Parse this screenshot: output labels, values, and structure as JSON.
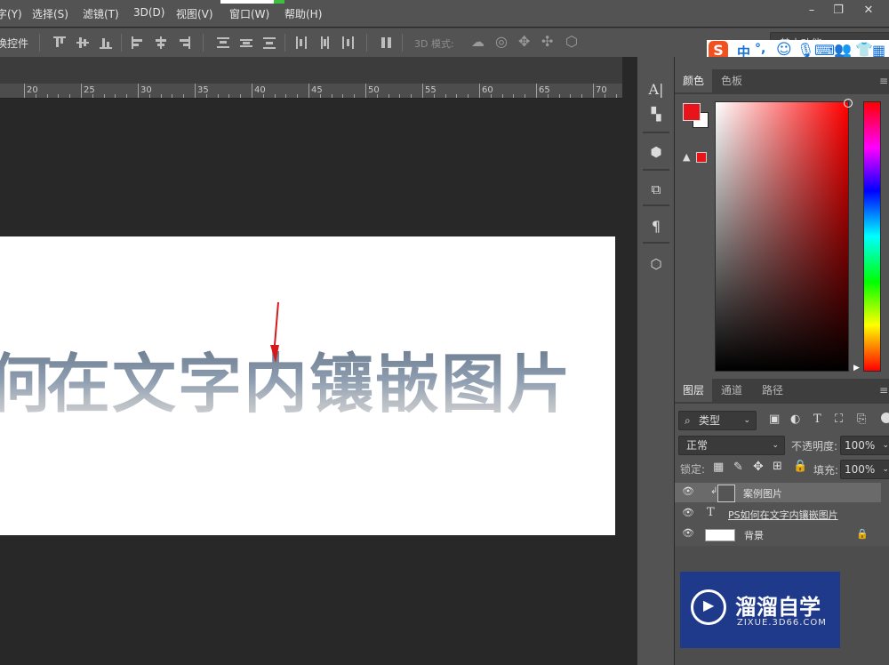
{
  "menu": {
    "items": [
      "字(Y)",
      "选择(S)",
      "滤镜(T)",
      "3D(D)",
      "视图(V)",
      "窗口(W)",
      "帮助(H)"
    ],
    "window_controls": [
      "–",
      "❐",
      "✕"
    ]
  },
  "options_bar": {
    "label": "换控件",
    "mode_label": "3D 模式:",
    "workspace": "基本功能"
  },
  "ime": {
    "chars": [
      "中",
      "°,"
    ]
  },
  "ruler": {
    "numbers": [
      "20",
      "25",
      "30",
      "35",
      "40",
      "45",
      "50",
      "55",
      "60",
      "65",
      "70"
    ]
  },
  "canvas": {
    "text_chars": [
      "何",
      "在",
      "文",
      "字",
      "内",
      "镶",
      "嵌",
      "图",
      "片"
    ]
  },
  "color_panel": {
    "tabs": [
      "颜色",
      "色板"
    ],
    "foreground_color": "#e8141a",
    "background_color": "#ffffff",
    "warning_color": "#e8141a"
  },
  "layers_panel": {
    "tabs": [
      "图层",
      "通道",
      "路径"
    ],
    "filter_label": "类型",
    "blend_mode": "正常",
    "opacity_label": "不透明度:",
    "opacity_value": "100%",
    "lock_label": "锁定:",
    "fill_label": "填充:",
    "fill_value": "100%",
    "layers": [
      {
        "name": "案例图片",
        "kind": "smart-object",
        "selected": true
      },
      {
        "name": "PS如何在文字内镶嵌图片",
        "kind": "text",
        "selected": false
      },
      {
        "name": "背景",
        "kind": "background",
        "selected": false
      }
    ]
  },
  "watermark": {
    "title": "溜溜自学",
    "subtitle": "ZIXUE.3D66.COM"
  },
  "colors": {
    "accent_red": "#e8141a",
    "ui_gray": "#535353",
    "watermark_blue": "#1f3a8a"
  }
}
